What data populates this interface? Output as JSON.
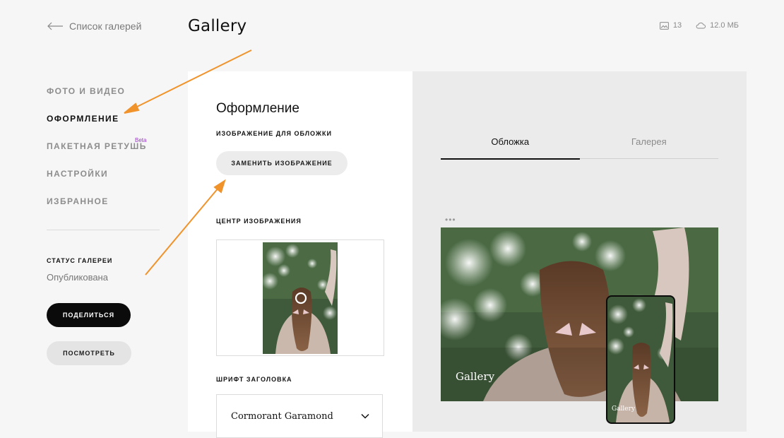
{
  "header": {
    "back_label": "Список галерей",
    "title": "Gallery",
    "photo_count": "13",
    "storage": "12.0 МБ"
  },
  "sidebar": {
    "items": [
      {
        "label": "ФОТО И ВИДЕО",
        "active": false
      },
      {
        "label": "ОФОРМЛЕНИЕ",
        "active": true
      },
      {
        "label": "ПАКЕТНАЯ РЕТУШЬ",
        "active": false,
        "badge": "Beta"
      },
      {
        "label": "НАСТРОЙКИ",
        "active": false
      },
      {
        "label": "ИЗБРАННОЕ",
        "active": false
      }
    ],
    "status_label": "СТАТУС ГАЛЕРЕИ",
    "status_value": "Опубликована",
    "share_label": "ПОДЕЛИТЬСЯ",
    "view_label": "ПОСМОТРЕТЬ"
  },
  "design": {
    "title": "Оформление",
    "cover_label": "ИЗОБРАЖЕНИЕ ДЛЯ ОБЛОЖКИ",
    "replace_label": "ЗАМЕНИТЬ ИЗОБРАЖЕНИЕ",
    "focus_label": "ЦЕНТР ИЗОБРАЖЕНИЯ",
    "font_label": "ШРИФТ ЗАГОЛОВКА",
    "font_value": "Cormorant Garamond"
  },
  "preview": {
    "tabs": [
      {
        "label": "Обложка",
        "active": true
      },
      {
        "label": "Галерея",
        "active": false
      }
    ],
    "cover_title": "Gallery",
    "phone_title": "Gallery"
  },
  "colors": {
    "accent_arrow": "#f0932b",
    "beta_badge": "#9b34c9",
    "primary_button": "#0b0b0b"
  },
  "icons": {
    "back": "arrow-left-icon",
    "photos": "image-icon",
    "storage": "cloud-icon",
    "select": "chevron-down-icon",
    "more": "more-dots-icon",
    "focus": "focus-ring-icon"
  }
}
